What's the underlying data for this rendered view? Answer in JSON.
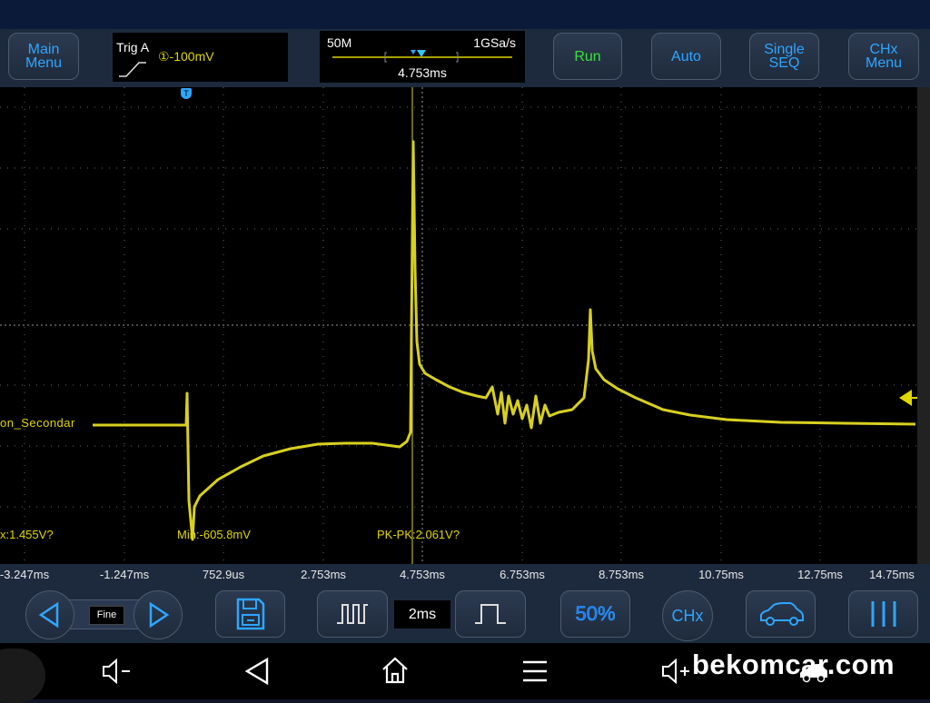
{
  "toolbar": {
    "main_menu": "Main Menu",
    "trig_label": "Trig A",
    "trig_level": "①-100mV",
    "memory": "50M",
    "sample_rate": "1GSa/s",
    "time_position": "4.753ms",
    "run": "Run",
    "auto": "Auto",
    "single_seq": "Single SEQ",
    "chx_menu": "CHx Menu"
  },
  "scope": {
    "trigger_marker": "T",
    "channel_name": "on_Secondar",
    "measurements": {
      "max": "x:1.455V?",
      "min": "Min:-605.8mV",
      "pkpk": "PK-PK:2.061V?"
    }
  },
  "x_axis": [
    "-3.247ms",
    "-1.247ms",
    "752.9us",
    "2.753ms",
    "4.753ms",
    "6.753ms",
    "8.753ms",
    "10.75ms",
    "12.75ms",
    "14.75ms"
  ],
  "controls": {
    "fine": "Fine",
    "timebase": "2ms",
    "fifty_percent": "50%",
    "chx": "CHx"
  },
  "watermark": "bekomcar.com",
  "colors": {
    "trace": "#d8d020",
    "accent": "#2ea6ff",
    "run": "#3be03b"
  }
}
